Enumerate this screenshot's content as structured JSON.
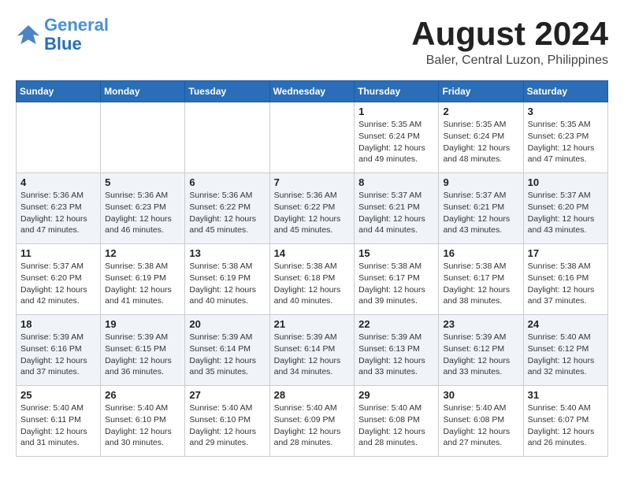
{
  "logo": {
    "line1": "General",
    "line2": "Blue"
  },
  "title": {
    "month_year": "August 2024",
    "location": "Baler, Central Luzon, Philippines"
  },
  "weekdays": [
    "Sunday",
    "Monday",
    "Tuesday",
    "Wednesday",
    "Thursday",
    "Friday",
    "Saturday"
  ],
  "weeks": [
    [
      {
        "day": "",
        "info": ""
      },
      {
        "day": "",
        "info": ""
      },
      {
        "day": "",
        "info": ""
      },
      {
        "day": "",
        "info": ""
      },
      {
        "day": "1",
        "info": "Sunrise: 5:35 AM\nSunset: 6:24 PM\nDaylight: 12 hours\nand 49 minutes."
      },
      {
        "day": "2",
        "info": "Sunrise: 5:35 AM\nSunset: 6:24 PM\nDaylight: 12 hours\nand 48 minutes."
      },
      {
        "day": "3",
        "info": "Sunrise: 5:35 AM\nSunset: 6:23 PM\nDaylight: 12 hours\nand 47 minutes."
      }
    ],
    [
      {
        "day": "4",
        "info": "Sunrise: 5:36 AM\nSunset: 6:23 PM\nDaylight: 12 hours\nand 47 minutes."
      },
      {
        "day": "5",
        "info": "Sunrise: 5:36 AM\nSunset: 6:23 PM\nDaylight: 12 hours\nand 46 minutes."
      },
      {
        "day": "6",
        "info": "Sunrise: 5:36 AM\nSunset: 6:22 PM\nDaylight: 12 hours\nand 45 minutes."
      },
      {
        "day": "7",
        "info": "Sunrise: 5:36 AM\nSunset: 6:22 PM\nDaylight: 12 hours\nand 45 minutes."
      },
      {
        "day": "8",
        "info": "Sunrise: 5:37 AM\nSunset: 6:21 PM\nDaylight: 12 hours\nand 44 minutes."
      },
      {
        "day": "9",
        "info": "Sunrise: 5:37 AM\nSunset: 6:21 PM\nDaylight: 12 hours\nand 43 minutes."
      },
      {
        "day": "10",
        "info": "Sunrise: 5:37 AM\nSunset: 6:20 PM\nDaylight: 12 hours\nand 43 minutes."
      }
    ],
    [
      {
        "day": "11",
        "info": "Sunrise: 5:37 AM\nSunset: 6:20 PM\nDaylight: 12 hours\nand 42 minutes."
      },
      {
        "day": "12",
        "info": "Sunrise: 5:38 AM\nSunset: 6:19 PM\nDaylight: 12 hours\nand 41 minutes."
      },
      {
        "day": "13",
        "info": "Sunrise: 5:38 AM\nSunset: 6:19 PM\nDaylight: 12 hours\nand 40 minutes."
      },
      {
        "day": "14",
        "info": "Sunrise: 5:38 AM\nSunset: 6:18 PM\nDaylight: 12 hours\nand 40 minutes."
      },
      {
        "day": "15",
        "info": "Sunrise: 5:38 AM\nSunset: 6:17 PM\nDaylight: 12 hours\nand 39 minutes."
      },
      {
        "day": "16",
        "info": "Sunrise: 5:38 AM\nSunset: 6:17 PM\nDaylight: 12 hours\nand 38 minutes."
      },
      {
        "day": "17",
        "info": "Sunrise: 5:38 AM\nSunset: 6:16 PM\nDaylight: 12 hours\nand 37 minutes."
      }
    ],
    [
      {
        "day": "18",
        "info": "Sunrise: 5:39 AM\nSunset: 6:16 PM\nDaylight: 12 hours\nand 37 minutes."
      },
      {
        "day": "19",
        "info": "Sunrise: 5:39 AM\nSunset: 6:15 PM\nDaylight: 12 hours\nand 36 minutes."
      },
      {
        "day": "20",
        "info": "Sunrise: 5:39 AM\nSunset: 6:14 PM\nDaylight: 12 hours\nand 35 minutes."
      },
      {
        "day": "21",
        "info": "Sunrise: 5:39 AM\nSunset: 6:14 PM\nDaylight: 12 hours\nand 34 minutes."
      },
      {
        "day": "22",
        "info": "Sunrise: 5:39 AM\nSunset: 6:13 PM\nDaylight: 12 hours\nand 33 minutes."
      },
      {
        "day": "23",
        "info": "Sunrise: 5:39 AM\nSunset: 6:12 PM\nDaylight: 12 hours\nand 33 minutes."
      },
      {
        "day": "24",
        "info": "Sunrise: 5:40 AM\nSunset: 6:12 PM\nDaylight: 12 hours\nand 32 minutes."
      }
    ],
    [
      {
        "day": "25",
        "info": "Sunrise: 5:40 AM\nSunset: 6:11 PM\nDaylight: 12 hours\nand 31 minutes."
      },
      {
        "day": "26",
        "info": "Sunrise: 5:40 AM\nSunset: 6:10 PM\nDaylight: 12 hours\nand 30 minutes."
      },
      {
        "day": "27",
        "info": "Sunrise: 5:40 AM\nSunset: 6:10 PM\nDaylight: 12 hours\nand 29 minutes."
      },
      {
        "day": "28",
        "info": "Sunrise: 5:40 AM\nSunset: 6:09 PM\nDaylight: 12 hours\nand 28 minutes."
      },
      {
        "day": "29",
        "info": "Sunrise: 5:40 AM\nSunset: 6:08 PM\nDaylight: 12 hours\nand 28 minutes."
      },
      {
        "day": "30",
        "info": "Sunrise: 5:40 AM\nSunset: 6:08 PM\nDaylight: 12 hours\nand 27 minutes."
      },
      {
        "day": "31",
        "info": "Sunrise: 5:40 AM\nSunset: 6:07 PM\nDaylight: 12 hours\nand 26 minutes."
      }
    ]
  ]
}
